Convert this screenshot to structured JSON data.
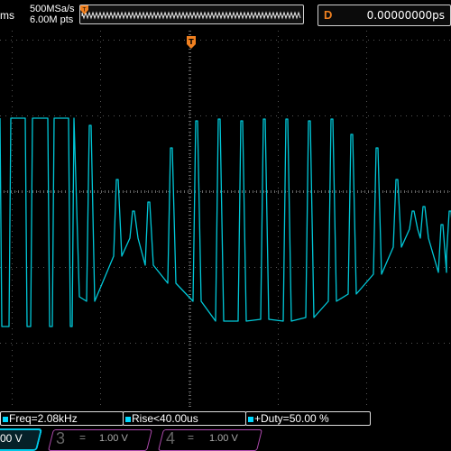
{
  "header": {
    "timebase_fragment": "ms",
    "sample_rate": "500MSa/s",
    "memory_depth": "6.00M pts",
    "delay_label": "D",
    "delay_value": "0.00000000ps"
  },
  "colors": {
    "trace": "#00c8d8",
    "trigger": "#f08020",
    "grid": "#444444"
  },
  "measurements": {
    "freq": "Freq=2.08kHz",
    "rise": "Rise<40.00us",
    "duty": "+Duty=50.00 %"
  },
  "channels": {
    "ch1_scale": "00 V",
    "ch3_num": "3",
    "ch3_coupling": "=",
    "ch3_scale": "1.00 V",
    "ch4_num": "4",
    "ch4_coupling": "=",
    "ch4_scale": "1.00 V"
  },
  "icons": {
    "trigger_marker": "trigger-position-icon",
    "ch1_marker": "channel-1-indicator"
  }
}
